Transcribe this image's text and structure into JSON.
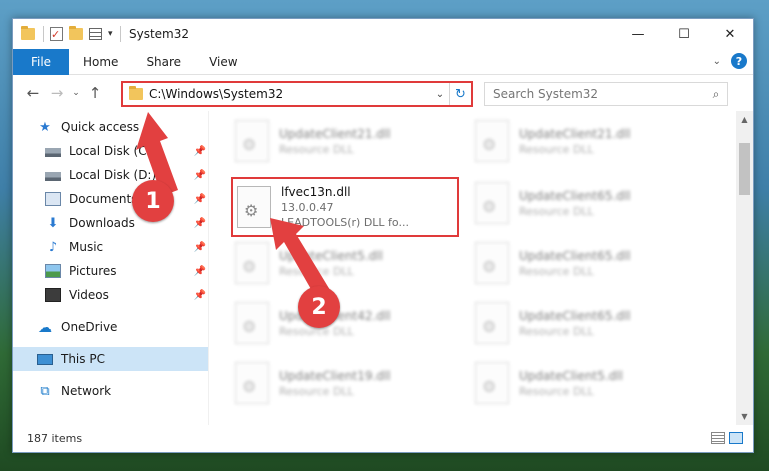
{
  "window": {
    "title": "System32",
    "controls": {
      "minimize": "—",
      "maximize": "☐",
      "close": "✕"
    }
  },
  "ribbon": {
    "tabs": [
      "File",
      "Home",
      "Share",
      "View"
    ],
    "expand_icon": "chevron-down-icon",
    "help": "?"
  },
  "nav": {
    "address": "C:\\Windows\\System32",
    "search_placeholder": "Search System32"
  },
  "sidebar": {
    "quick_access": "Quick access",
    "items": [
      {
        "label": "Local Disk (C:)",
        "icon": "disk-icon"
      },
      {
        "label": "Local Disk (D:)",
        "icon": "disk-icon"
      },
      {
        "label": "Documents",
        "icon": "documents-icon"
      },
      {
        "label": "Downloads",
        "icon": "downloads-icon"
      },
      {
        "label": "Music",
        "icon": "music-icon"
      },
      {
        "label": "Pictures",
        "icon": "pictures-icon"
      },
      {
        "label": "Videos",
        "icon": "videos-icon"
      }
    ],
    "onedrive": "OneDrive",
    "this_pc": "This PC",
    "network": "Network"
  },
  "files": {
    "highlighted": {
      "name": "lfvec13n.dll",
      "version": "13.0.0.47",
      "desc": "LEADTOOLS(r) DLL fo..."
    },
    "left_column": [
      {
        "name": "UpdateClient21.dll",
        "type": "Resource DLL"
      },
      {
        "name": "UpdateClient5.dll",
        "type": "Resource DLL"
      },
      {
        "name": "UpdateClient42.dll",
        "type": "Resource DLL"
      },
      {
        "name": "UpdateClient19.dll",
        "type": "Resource DLL"
      }
    ],
    "right_column": [
      {
        "name": "UpdateClient21.dll",
        "type": "Resource DLL"
      },
      {
        "name": "UpdateClient65.dll",
        "type": "Resource DLL"
      },
      {
        "name": "UpdateClient65.dll",
        "type": "Resource DLL"
      },
      {
        "name": "UpdateClient65.dll",
        "type": "Resource DLL"
      },
      {
        "name": "UpdateClient5.dll",
        "type": "Resource DLL"
      }
    ]
  },
  "status": {
    "count": "187 items"
  },
  "annotations": {
    "step1": "1",
    "step2": "2",
    "color": "#e24040"
  }
}
